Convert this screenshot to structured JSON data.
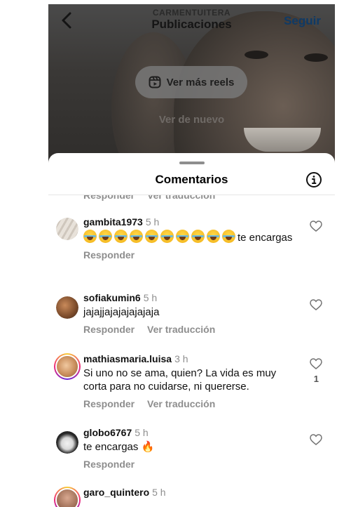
{
  "header": {
    "username": "CARMENTUITERA",
    "title": "Publicaciones",
    "follow_label": "Seguir"
  },
  "video": {
    "reels_label": "Ver más reels",
    "rewatch_label": "Ver de nuevo"
  },
  "sheet": {
    "title": "Comentarios",
    "cut_actions": [
      "Responder",
      "Ver traducción"
    ]
  },
  "comments": [
    {
      "user": "gambita1973",
      "time": "5 h",
      "emoji_count": 10,
      "text": "te encargas",
      "actions": [
        "Responder"
      ],
      "likes": ""
    },
    {
      "user": "sofiakumin6",
      "time": "5 h",
      "text": "jajajjajajajajajaja",
      "actions": [
        "Responder",
        "Ver traducción"
      ],
      "likes": ""
    },
    {
      "user": "mathiasmaria.luisa",
      "time": "3 h",
      "text": "Si uno no se ama, quien? La vida es muy corta para no cuidarse, ni quererse.",
      "actions": [
        "Responder",
        "Ver traducción"
      ],
      "likes": "1"
    },
    {
      "user": "globo6767",
      "time": "5 h",
      "text": "te encargas 🔥",
      "actions": [
        "Responder"
      ],
      "likes": ""
    },
    {
      "user": "garo_quintero",
      "time": "5 h",
      "text": "",
      "actions": [],
      "likes": ""
    }
  ],
  "colors": {
    "accent": "#0f3a66",
    "muted_text": "#8e8e8e",
    "sheet_bg": "#ffffff"
  }
}
